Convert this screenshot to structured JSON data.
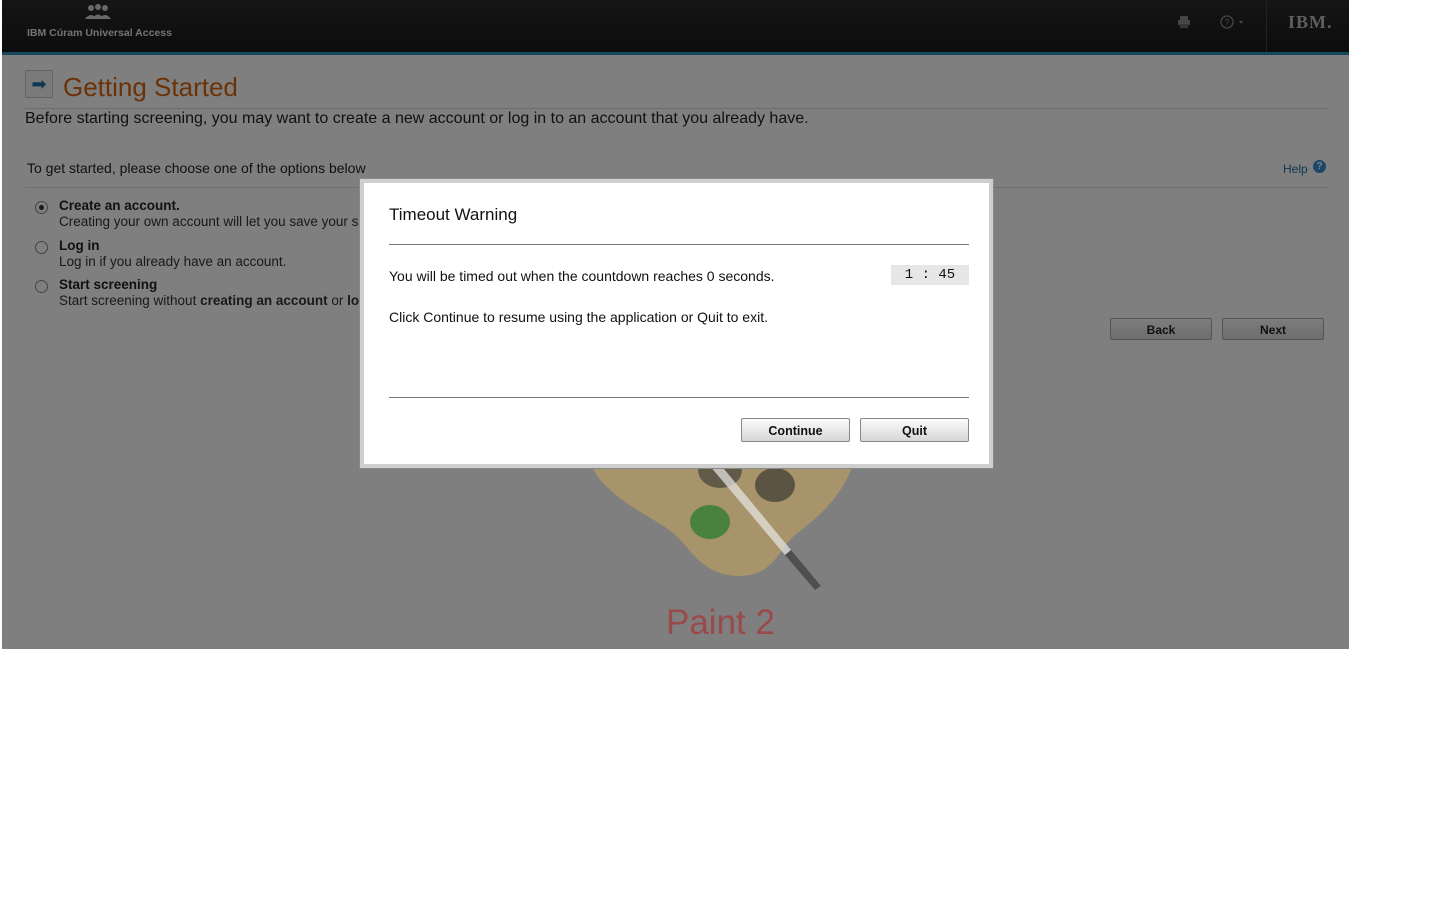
{
  "header": {
    "brand": "IBM Cúram Universal Access",
    "print_icon": "printer-icon",
    "help_icon": "help-circle-icon",
    "logo": "IBM."
  },
  "page": {
    "title": "Getting Started",
    "intro": "Before starting screening, you may want to create a new account or log in to an account that you already have.",
    "choose_label": "To get started, please choose one of the options below",
    "help_link": "Help",
    "options": [
      {
        "title": "Create an account.",
        "desc": "Creating your own account will let you save your s",
        "selected": true
      },
      {
        "title": "Log in",
        "desc": "Log in if you already have an account.",
        "selected": false
      },
      {
        "title": "Start screening",
        "desc_pre": "Start screening without ",
        "desc_bold": "creating an account",
        "desc_post": " or ",
        "desc_bold2": "lo",
        "selected": false
      }
    ],
    "back_label": "Back",
    "next_label": "Next"
  },
  "watermark": {
    "label": "Paint 2"
  },
  "dialog": {
    "title": "Timeout Warning",
    "message": "You will be timed out when the countdown reaches 0 seconds.",
    "countdown": "1 : 45",
    "message2": "Click Continue to resume using the application or Quit to exit.",
    "continue_label": "Continue",
    "quit_label": "Quit"
  }
}
